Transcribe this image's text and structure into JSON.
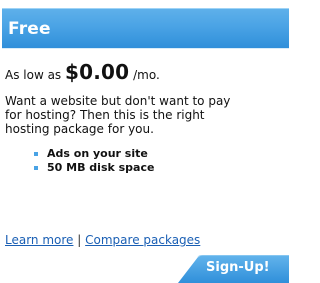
{
  "plan": {
    "title": "Free",
    "price_prefix": "As low as",
    "price": "$0.00",
    "price_suffix": "/mo.",
    "description_lines": [
      "Want a website but don't want to pay",
      "for hosting? Then this is the right",
      "hosting package for you."
    ],
    "features": [
      "Ads on your site",
      "50 MB disk space"
    ]
  },
  "links": {
    "learn_more": "Learn more",
    "separator": "|",
    "compare": "Compare packages"
  },
  "signup": {
    "label": "Sign-Up!"
  },
  "colors": {
    "header": "#4aa3e5",
    "link": "#1a5fb4",
    "bullet": "#4aa3e5"
  }
}
